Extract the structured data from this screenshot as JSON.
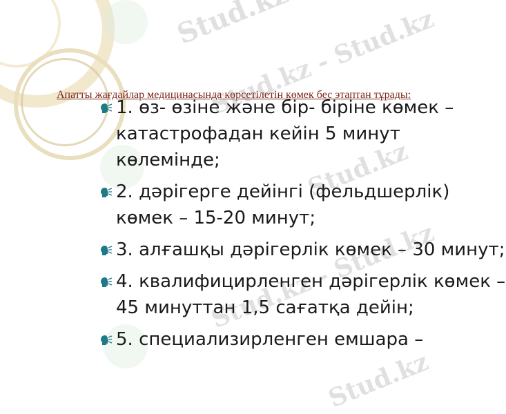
{
  "slide": {
    "title": "Апатты жағдайлар медицинасында көрсетілетін көмек бес этаптан тұрады:",
    "items": [
      {
        "text": "1. өз- өзіне және бір- біріне көмек – катастрофадан кейін 5 минут көлемінде;"
      },
      {
        "text": "2. дәрігерге дейінгі (фельдшерлік) көмек – 15-20 минут;"
      },
      {
        "text": "3. алғашқы дәрігерлік көмек – 30 минут;"
      },
      {
        "text": "4. квалифицирленген дәрігерлік көмек –  45 минуттан 1,5 сағатқа дейін;"
      },
      {
        "text": "5. специализирленген емшара –"
      }
    ],
    "bullet_icon": "head-bullet-icon"
  },
  "watermark": {
    "text": "Stud.kz",
    "prefix_text": "Stud.kz - Stud.kz"
  },
  "colors": {
    "title": "#7a2416",
    "body_text": "#1a1a1a",
    "bullet": "#1e7a86",
    "ring": "#e9dfbe",
    "watermark": "#c9c7c7"
  }
}
